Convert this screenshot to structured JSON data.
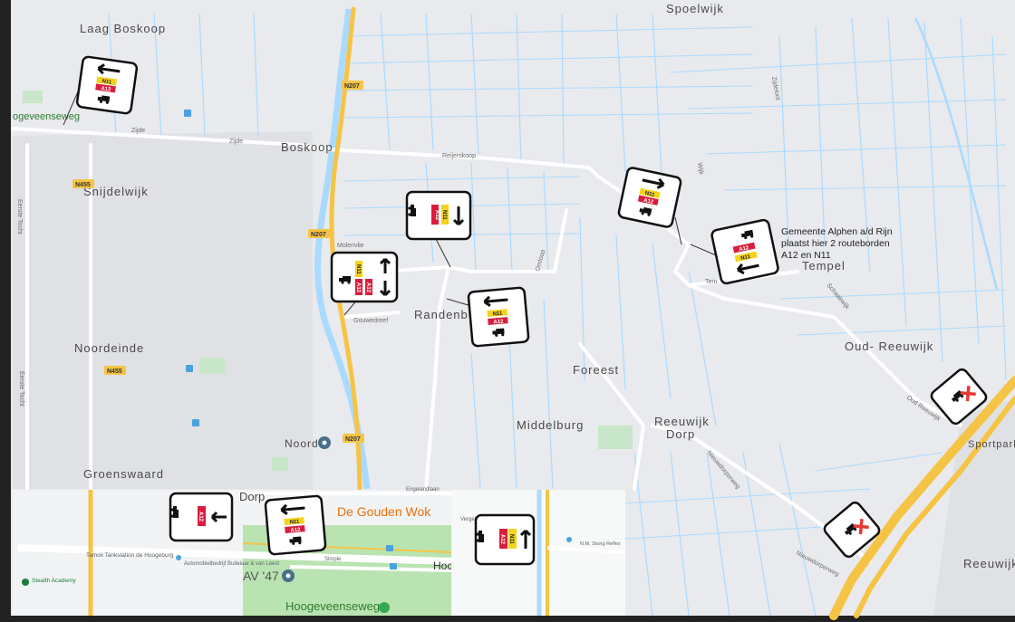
{
  "map": {
    "places": {
      "laag_boskoop": "Laag Boskoop",
      "spoelwijk": "Spoelwijk",
      "boskoop": "Boskoop",
      "snijdelwijk": "Snijdelwijk",
      "noordeinde": "Noordeinde",
      "groenswaard": "Groenswaard",
      "randenburg": "Randenburg",
      "tempel": "Tempel",
      "foreest": "Foreest",
      "middelburg": "Middelburg",
      "reeuwijk_dorp_1": "Reeuwijk",
      "reeuwijk_dorp_2": "Dorp",
      "oud_reeuwijk": "Oud- Reeuwijk",
      "reeuwijk": "Reeuwijk",
      "sportpark": "Sportpark",
      "noord": "Noord",
      "hogeveenseweg_left": "ogeveenseweg"
    },
    "streets": {
      "zijde": "Zijde",
      "zijde2": "Zijde",
      "reijerskoop": "Reijerskoop",
      "molenvlie": "Molenvlie",
      "gouwedreef": "Gouwedreef",
      "omloop": "Omloop",
      "wijk": "Wijk",
      "tempel_street": "Tem",
      "schaakwijk": "Schaakwijk",
      "oud_reeuwijk_street": "Oud Reeuwijk",
      "nieuwdorperweg": "Nieuwdorperweg",
      "nieuwdorperweg2": "Nieuwdorperweg",
      "eerste_tocht": "Eerste Tocht",
      "eerste_tocht2": "Eerste Tocht",
      "ziibelaan": "Zijdeloot"
    },
    "shields": {
      "n207_top": "N207",
      "n207_mid": "N207",
      "n207_low": "N207",
      "n455_top": "N455",
      "n455_low": "N455"
    },
    "callout": {
      "line1": "Gemeente Alphen a/d Rijn",
      "line2": "plaatst hier 2 routeborden",
      "line3": "A12 en N11"
    },
    "sign_labels": {
      "n11": "N11",
      "a12": "A12"
    }
  },
  "insets": {
    "left": {
      "street1": "Tamoil Tankstation de Hoogeburg",
      "street2": "Automobielbedrijf Buitelaar & van Leest",
      "poi": "Stealth Academy",
      "dorp": "Dorp",
      "restaurant": "De Gouden Wok",
      "av47": "AV '47",
      "hoogeveenseweg": "Hoogeveenseweg",
      "hoc": "Hoc",
      "simple": "Simple",
      "engelandlaan": "Engelandlaan"
    },
    "right": {
      "poi1": "Vergel",
      "poi2": "N.M. Stong Reflex"
    }
  },
  "colors": {
    "land": "#e8eaed",
    "water": "#aadaff",
    "road": "#ffffff",
    "highway": "#f6c445",
    "sign_yellow": "#f4d31a",
    "sign_red": "#d81e3c",
    "park": "#c8e6c9"
  }
}
